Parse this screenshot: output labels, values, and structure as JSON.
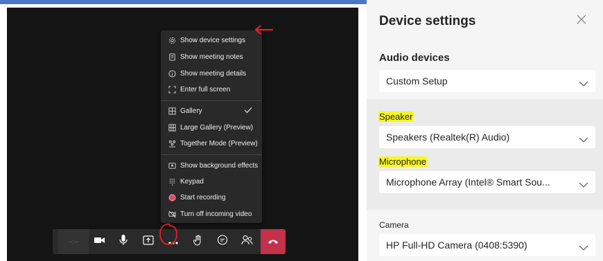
{
  "menu": {
    "items": [
      {
        "label": "Show device settings",
        "icon": "gear-icon"
      },
      {
        "label": "Show meeting notes",
        "icon": "notes-icon"
      },
      {
        "label": "Show meeting details",
        "icon": "info-icon"
      },
      {
        "label": "Enter full screen",
        "icon": "fullscreen-icon"
      },
      {
        "label": "Gallery",
        "icon": "gallery-icon",
        "checked": true
      },
      {
        "label": "Large Gallery (Preview)",
        "icon": "large-gallery-icon"
      },
      {
        "label": "Together Mode (Preview)",
        "icon": "together-mode-icon"
      },
      {
        "label": "Show background effects",
        "icon": "background-effects-icon"
      },
      {
        "label": "Keypad",
        "icon": "keypad-icon"
      },
      {
        "label": "Start recording",
        "icon": "record-icon"
      },
      {
        "label": "Turn off incoming video",
        "icon": "video-off-icon"
      }
    ]
  },
  "toolbar": {
    "timer": "--:--",
    "buttons": [
      "camera-icon",
      "microphone-icon",
      "share-screen-icon",
      "more-options-icon",
      "raise-hand-icon",
      "chat-icon",
      "participants-icon",
      "hang-up-icon"
    ]
  },
  "panel": {
    "title": "Device settings",
    "audio_devices_label": "Audio devices",
    "audio_devices_value": "Custom Setup",
    "speaker_label": "Speaker",
    "speaker_value": "Speakers (Realtek(R) Audio)",
    "microphone_label": "Microphone",
    "microphone_value": "Microphone Array (Intel® Smart Sou...",
    "camera_label": "Camera",
    "camera_value": "HP Full-HD Camera (0408:5390)"
  },
  "colors": {
    "annotation_red": "#e0202a",
    "highlight_yellow": "#f7f721",
    "hangup_red": "#c4314b"
  }
}
